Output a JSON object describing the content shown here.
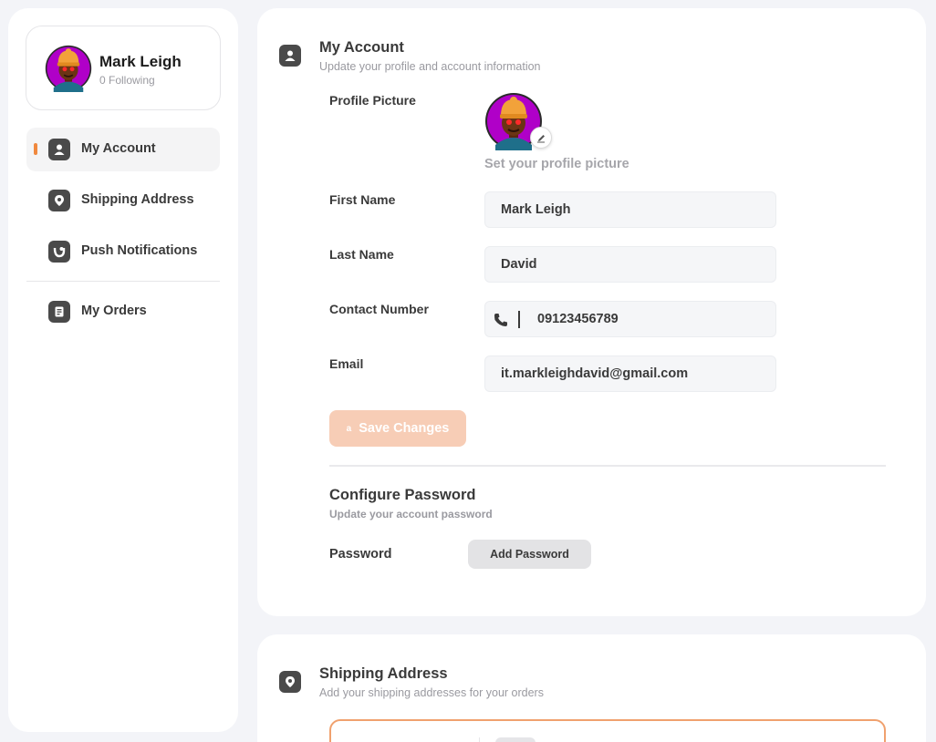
{
  "sidebar": {
    "profile": {
      "name": "Mark Leigh",
      "following": "0 Following"
    },
    "items": [
      {
        "label": "My Account",
        "icon": "user-icon",
        "active": true
      },
      {
        "label": "Shipping Address",
        "icon": "location-pin-icon",
        "active": false
      },
      {
        "label": "Push Notifications",
        "icon": "bell-icon",
        "active": false
      },
      {
        "label": "My Orders",
        "icon": "clipboard-icon",
        "active": false
      }
    ]
  },
  "account": {
    "title": "My Account",
    "subtitle": "Update your profile and account information",
    "picture_label": "Profile Picture",
    "picture_hint": "Set your profile picture",
    "fields": {
      "first_name": {
        "label": "First Name",
        "value": "Mark Leigh"
      },
      "last_name": {
        "label": "Last Name",
        "value": "David"
      },
      "contact": {
        "label": "Contact Number",
        "value": "09123456789"
      },
      "email": {
        "label": "Email",
        "value": "it.markleighdavid@gmail.com"
      }
    },
    "save_icon_char": "a",
    "save_label": "Save Changes"
  },
  "password": {
    "title": "Configure Password",
    "subtitle": "Update your account password",
    "label": "Password",
    "button": "Add Password"
  },
  "shipping": {
    "title": "Shipping Address",
    "subtitle": "Add your shipping addresses for your orders"
  },
  "colors": {
    "accent": "#f0883e",
    "save_disabled": "#f7cdb6",
    "avatar_bg": "#b000c8",
    "icon_bg": "#4a4a4a"
  }
}
